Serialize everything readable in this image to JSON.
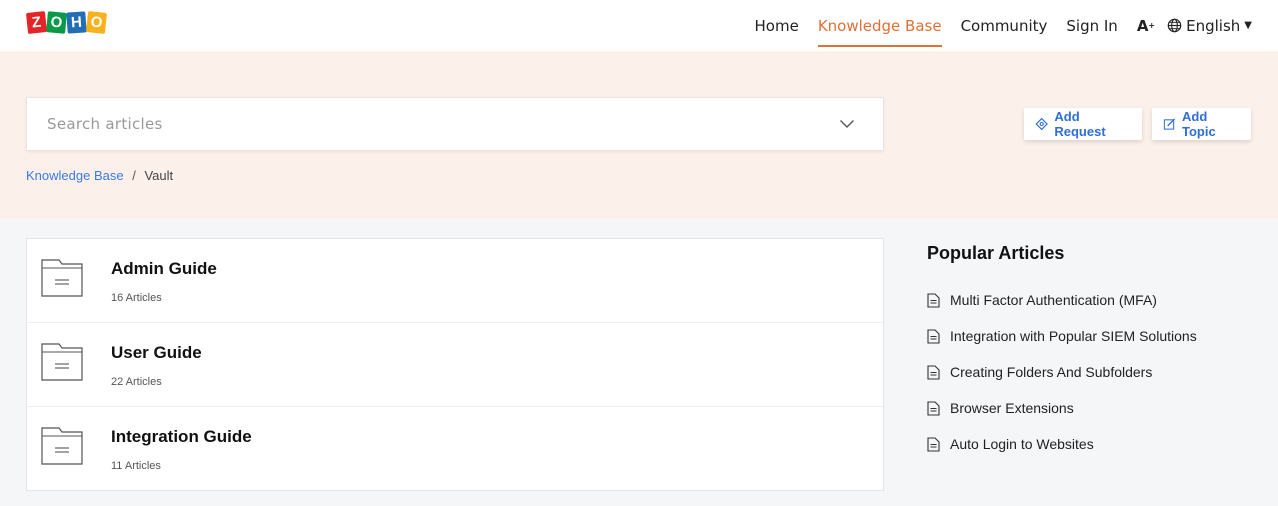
{
  "brand": {
    "letters": [
      "Z",
      "O",
      "H",
      "O"
    ],
    "colors": [
      "#e42527",
      "#089949",
      "#226db4",
      "#f9b21d"
    ]
  },
  "nav": {
    "items": [
      {
        "label": "Home",
        "active": false
      },
      {
        "label": "Knowledge Base",
        "active": true
      },
      {
        "label": "Community",
        "active": false
      },
      {
        "label": "Sign In",
        "active": false
      }
    ],
    "font_size_icon": "A",
    "language": "English",
    "accent": "#e07034"
  },
  "search": {
    "placeholder": "Search articles",
    "icon": "chevron-down-icon"
  },
  "breadcrumb": {
    "root": "Knowledge Base",
    "separator": "/",
    "current": "Vault"
  },
  "actions": {
    "add_request": "Add Request",
    "add_topic": "Add Topic",
    "color": "#2f6ed8"
  },
  "categories": [
    {
      "title": "Admin Guide",
      "count": "16 Articles"
    },
    {
      "title": "User Guide",
      "count": "22 Articles"
    },
    {
      "title": "Integration Guide",
      "count": "11 Articles"
    }
  ],
  "popular": {
    "heading": "Popular Articles",
    "articles": [
      "Multi Factor Authentication (MFA)",
      "Integration with Popular SIEM Solutions",
      "Creating Folders And Subfolders",
      "Browser Extensions",
      "Auto Login to Websites"
    ]
  }
}
